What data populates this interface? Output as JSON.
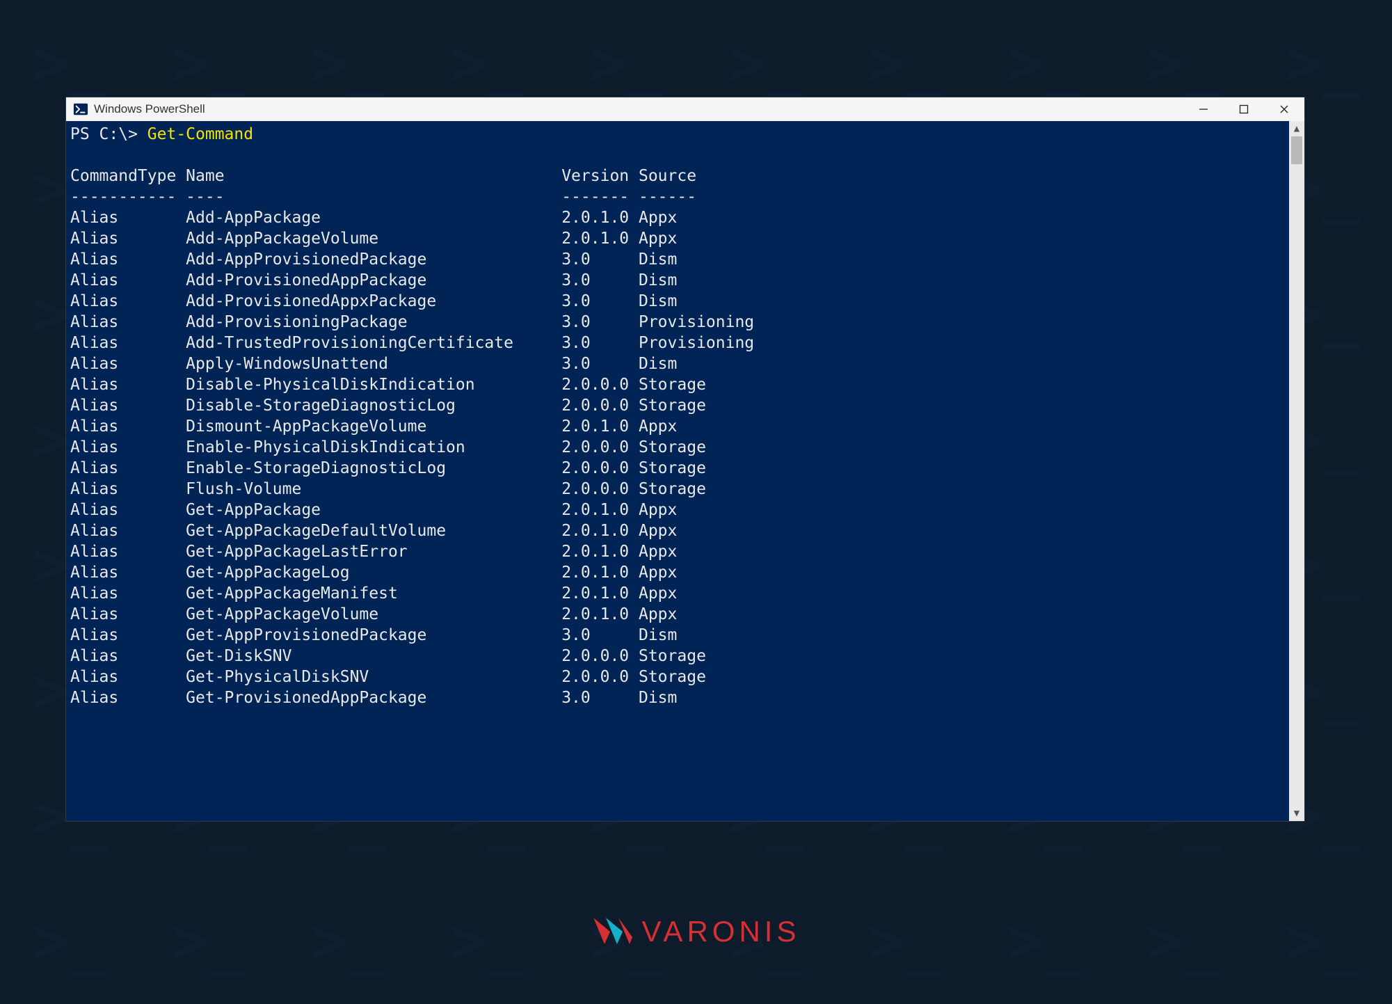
{
  "bg_glyph": ">_",
  "window": {
    "title": "Windows PowerShell",
    "prompt": "PS C:\\> ",
    "command": "Get-Command"
  },
  "columns": {
    "type": "CommandType",
    "name": "Name",
    "version": "Version",
    "source": "Source",
    "sep_type": "-----------",
    "sep_name": "----",
    "sep_version": "-------",
    "sep_source": "------"
  },
  "rows": [
    {
      "type": "Alias",
      "name": "Add-AppPackage",
      "version": "2.0.1.0",
      "source": "Appx"
    },
    {
      "type": "Alias",
      "name": "Add-AppPackageVolume",
      "version": "2.0.1.0",
      "source": "Appx"
    },
    {
      "type": "Alias",
      "name": "Add-AppProvisionedPackage",
      "version": "3.0",
      "source": "Dism"
    },
    {
      "type": "Alias",
      "name": "Add-ProvisionedAppPackage",
      "version": "3.0",
      "source": "Dism"
    },
    {
      "type": "Alias",
      "name": "Add-ProvisionedAppxPackage",
      "version": "3.0",
      "source": "Dism"
    },
    {
      "type": "Alias",
      "name": "Add-ProvisioningPackage",
      "version": "3.0",
      "source": "Provisioning"
    },
    {
      "type": "Alias",
      "name": "Add-TrustedProvisioningCertificate",
      "version": "3.0",
      "source": "Provisioning"
    },
    {
      "type": "Alias",
      "name": "Apply-WindowsUnattend",
      "version": "3.0",
      "source": "Dism"
    },
    {
      "type": "Alias",
      "name": "Disable-PhysicalDiskIndication",
      "version": "2.0.0.0",
      "source": "Storage"
    },
    {
      "type": "Alias",
      "name": "Disable-StorageDiagnosticLog",
      "version": "2.0.0.0",
      "source": "Storage"
    },
    {
      "type": "Alias",
      "name": "Dismount-AppPackageVolume",
      "version": "2.0.1.0",
      "source": "Appx"
    },
    {
      "type": "Alias",
      "name": "Enable-PhysicalDiskIndication",
      "version": "2.0.0.0",
      "source": "Storage"
    },
    {
      "type": "Alias",
      "name": "Enable-StorageDiagnosticLog",
      "version": "2.0.0.0",
      "source": "Storage"
    },
    {
      "type": "Alias",
      "name": "Flush-Volume",
      "version": "2.0.0.0",
      "source": "Storage"
    },
    {
      "type": "Alias",
      "name": "Get-AppPackage",
      "version": "2.0.1.0",
      "source": "Appx"
    },
    {
      "type": "Alias",
      "name": "Get-AppPackageDefaultVolume",
      "version": "2.0.1.0",
      "source": "Appx"
    },
    {
      "type": "Alias",
      "name": "Get-AppPackageLastError",
      "version": "2.0.1.0",
      "source": "Appx"
    },
    {
      "type": "Alias",
      "name": "Get-AppPackageLog",
      "version": "2.0.1.0",
      "source": "Appx"
    },
    {
      "type": "Alias",
      "name": "Get-AppPackageManifest",
      "version": "2.0.1.0",
      "source": "Appx"
    },
    {
      "type": "Alias",
      "name": "Get-AppPackageVolume",
      "version": "2.0.1.0",
      "source": "Appx"
    },
    {
      "type": "Alias",
      "name": "Get-AppProvisionedPackage",
      "version": "3.0",
      "source": "Dism"
    },
    {
      "type": "Alias",
      "name": "Get-DiskSNV",
      "version": "2.0.0.0",
      "source": "Storage"
    },
    {
      "type": "Alias",
      "name": "Get-PhysicalDiskSNV",
      "version": "2.0.0.0",
      "source": "Storage"
    },
    {
      "type": "Alias",
      "name": "Get-ProvisionedAppPackage",
      "version": "3.0",
      "source": "Dism"
    }
  ],
  "col_widths": {
    "type": 12,
    "name": 39,
    "version": 8,
    "source": 14
  },
  "brand": {
    "text": "VARONIS"
  },
  "colors": {
    "term_bg": "#012456",
    "cmd": "#f2e300",
    "brand": "#d53033"
  }
}
